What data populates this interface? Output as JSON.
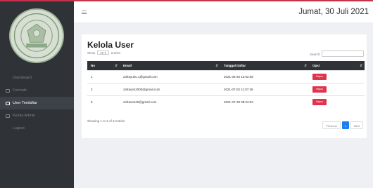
{
  "topbar": {
    "date": "Jumat, 30 Juli 2021"
  },
  "sidebar": {
    "items": [
      {
        "label": "Dashboard"
      },
      {
        "label": "Formulir"
      },
      {
        "label": "User Terdaftar"
      },
      {
        "label": "Kelola Admin"
      },
      {
        "label": "Logout"
      }
    ]
  },
  "card": {
    "title": "Kelola User",
    "show_prefix": "Show",
    "show_value": "10",
    "show_suffix": "entries",
    "search_label": "Search:",
    "columns": [
      "No",
      "Email",
      "Tanggal Daftar",
      "Opsi"
    ],
    "rows": [
      {
        "no": "1",
        "email": "zafrayuhu.1@gmail.com",
        "date": "2021-06-25 12:02:38",
        "action": "Hapus"
      },
      {
        "no": "2",
        "email": "zafrauim2000@gmail.com",
        "date": "2021-07-02 11:07:26",
        "action": "Hapus"
      },
      {
        "no": "3",
        "email": "zafrauim20@gmail.com",
        "date": "2021-07-30 08:24:02",
        "action": "Hapus"
      }
    ],
    "showing": "Showing 1 to 3 of 3 entries",
    "pagination": {
      "prev": "Previous",
      "current": "1",
      "next": "Next"
    }
  }
}
